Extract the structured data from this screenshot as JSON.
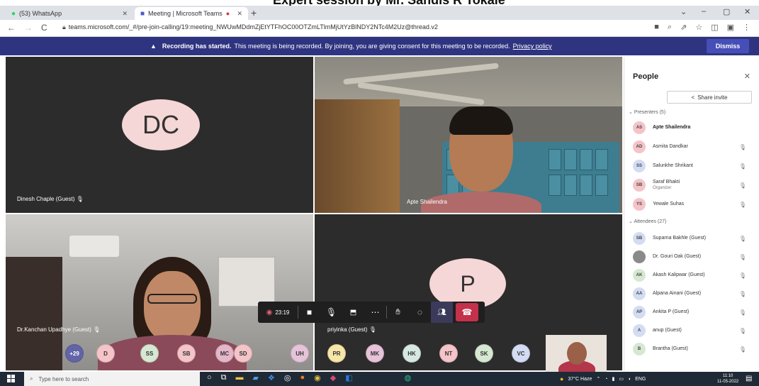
{
  "caption": "Expert session by Mr. Sandis R Tokale",
  "browser": {
    "tabs": [
      {
        "label": "(53) WhatsApp",
        "icon": "whatsapp-icon",
        "color": "#25d366"
      },
      {
        "label": "Meeting | Microsoft Teams",
        "icon": "teams-icon",
        "color": "#5059c9"
      }
    ],
    "new_tab": "+",
    "window_controls": [
      "⌄",
      "–",
      "▢",
      "✕"
    ],
    "url": "teams.microsoft.com/_#/pre-join-calling/19:meeting_NWUwMDdmZjEtYTFhOC00OTZmLTlmMjUtYzBlNDY2NTc4M2Uz@thread.v2",
    "nav": [
      "←",
      "→",
      "C"
    ]
  },
  "banner": {
    "bold": "Recording has started.",
    "text": "This meeting is being recorded. By joining, you are giving consent for this meeting to be recorded.",
    "link": "Privacy policy",
    "dismiss": "Dismiss"
  },
  "tiles": [
    {
      "initials": "DC",
      "name": "Dinesh Chaple (Guest)"
    },
    {
      "name": "Apte Shailendra"
    },
    {
      "name": "Dr.Kanchan Upadhye (Guest)"
    },
    {
      "initials": "P",
      "name": "priyinka (Guest)"
    }
  ],
  "callbar": {
    "timer": "23:19"
  },
  "bubbles": [
    {
      "label": "+29",
      "bg": "#6264a7",
      "fg": "#fff"
    },
    {
      "label": "D",
      "bg": "#f4c4c8",
      "fg": "#333"
    },
    {
      "label": "SS",
      "bg": "#d6e8d2",
      "fg": "#333"
    },
    {
      "label": "SB",
      "bg": "#f4c4c8",
      "fg": "#333"
    },
    {
      "label": "MC",
      "bg": "#e4b7c8",
      "fg": "#333"
    },
    {
      "label": "SD",
      "bg": "#f4c4c8",
      "fg": "#333"
    },
    {
      "label": "UH",
      "bg": "#e6c3d8",
      "fg": "#333"
    },
    {
      "label": "PR",
      "bg": "#f6e6a8",
      "fg": "#333"
    },
    {
      "label": "MK",
      "bg": "#e6c3d8",
      "fg": "#333"
    },
    {
      "label": "HK",
      "bg": "#d6e8e2",
      "fg": "#333"
    },
    {
      "label": "NT",
      "bg": "#f4c4c8",
      "fg": "#333"
    },
    {
      "label": "SK",
      "bg": "#d6e8d2",
      "fg": "#333"
    },
    {
      "label": "VC",
      "bg": "#d3dcf2",
      "fg": "#333"
    }
  ],
  "people": {
    "title": "People",
    "share": "Share invite",
    "presenters_label": "Presenters (5)",
    "presenters": [
      {
        "initials": "AS",
        "name": "Apte Shailendra",
        "role": "",
        "bg": "#f4c4c8",
        "bold": true
      },
      {
        "initials": "AD",
        "name": "Asmita Dandkar",
        "role": "",
        "bg": "#f4c4c8"
      },
      {
        "initials": "SS",
        "name": "Salunkhe Shrikant",
        "role": "",
        "bg": "#d3dcf2"
      },
      {
        "initials": "SB",
        "name": "Saraf Bhakti",
        "role": "Organizer",
        "bg": "#f4c4c8"
      },
      {
        "initials": "YS",
        "name": "Yewale Suhas",
        "role": "",
        "bg": "#f4c4c8"
      }
    ],
    "attendees_label": "Attendees (27)",
    "attendees": [
      {
        "initials": "SB",
        "name": "Suparna Bakhle (Guest)",
        "bg": "#d3dcf2"
      },
      {
        "initials": "",
        "name": "Dr. Gouri Oak (Guest)",
        "bg": "#8a8a8a"
      },
      {
        "initials": "AK",
        "name": "Akash Kalipwar (Guest)",
        "bg": "#d6e8d2"
      },
      {
        "initials": "AA",
        "name": "Alpana Ainani (Guest)",
        "bg": "#d3dcf2"
      },
      {
        "initials": "AP",
        "name": "Ankita P (Guest)",
        "bg": "#d3dcf2"
      },
      {
        "initials": "A",
        "name": "anup (Guest)",
        "bg": "#d3dcf2"
      },
      {
        "initials": "B",
        "name": "Brantha (Guest)",
        "bg": "#d6e8d2"
      }
    ]
  },
  "taskbar": {
    "search_placeholder": "Type here to search",
    "weather": "37°C Haze",
    "lang": "ENG",
    "time": "11:10",
    "date": "11-05-2022"
  }
}
